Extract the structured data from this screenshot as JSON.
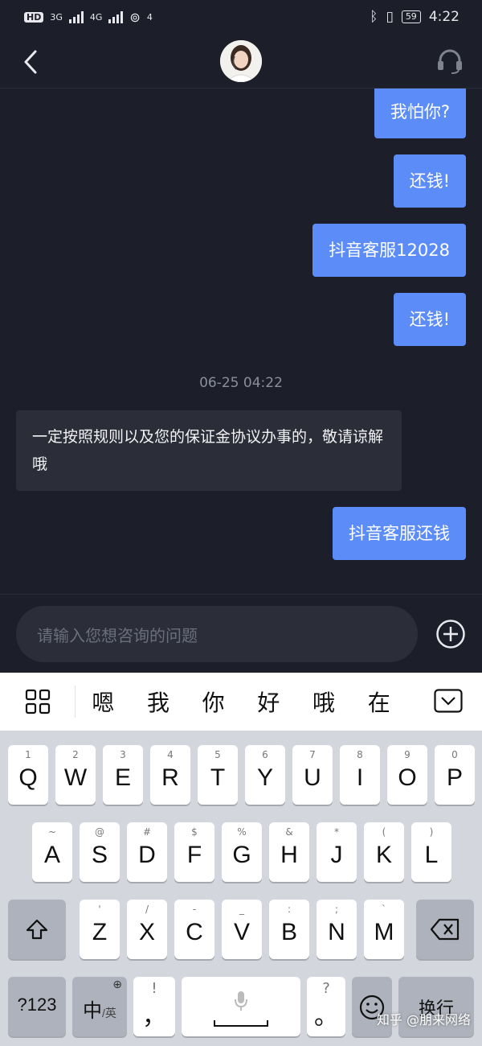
{
  "status_bar": {
    "hd_label": "HD",
    "net1": "3G",
    "net2": "4G",
    "hotspot_badge": "4",
    "battery": "59",
    "time": "4:22"
  },
  "nav": {
    "back_icon": "chevron-left-icon",
    "avatar": "customer-service-avatar",
    "headset_icon": "headset-icon"
  },
  "messages": [
    {
      "from": "me",
      "text": "我怕你?"
    },
    {
      "from": "me",
      "text": "还钱!"
    },
    {
      "from": "me",
      "text": "抖音客服12028"
    },
    {
      "from": "me",
      "text": "还钱!"
    },
    {
      "from": "timestamp",
      "text": "06-25 04:22"
    },
    {
      "from": "other",
      "text": "一定按照规则以及您的保证金协议办事的，敬请谅解哦"
    },
    {
      "from": "me",
      "text": "抖音客服还钱"
    }
  ],
  "input": {
    "placeholder": "请输入您想咨询的问题",
    "plus_icon": "plus-circle-icon"
  },
  "keyboard": {
    "candidates": [
      "嗯",
      "我",
      "你",
      "好",
      "哦",
      "在"
    ],
    "row1": [
      {
        "sub": "1",
        "main": "Q"
      },
      {
        "sub": "2",
        "main": "W"
      },
      {
        "sub": "3",
        "main": "E"
      },
      {
        "sub": "4",
        "main": "R"
      },
      {
        "sub": "5",
        "main": "T"
      },
      {
        "sub": "6",
        "main": "Y"
      },
      {
        "sub": "7",
        "main": "U"
      },
      {
        "sub": "8",
        "main": "I"
      },
      {
        "sub": "9",
        "main": "O"
      },
      {
        "sub": "0",
        "main": "P"
      }
    ],
    "row2": [
      {
        "sub": "~",
        "main": "A"
      },
      {
        "sub": "@",
        "main": "S"
      },
      {
        "sub": "#",
        "main": "D"
      },
      {
        "sub": "$",
        "main": "F"
      },
      {
        "sub": "%",
        "main": "G"
      },
      {
        "sub": "&",
        "main": "H"
      },
      {
        "sub": "*",
        "main": "J"
      },
      {
        "sub": "(",
        "main": "K"
      },
      {
        "sub": ")",
        "main": "L"
      }
    ],
    "row3": [
      {
        "sub": "'",
        "main": "Z"
      },
      {
        "sub": "/",
        "main": "X"
      },
      {
        "sub": "-",
        "main": "C"
      },
      {
        "sub": "_",
        "main": "V"
      },
      {
        "sub": ":",
        "main": "B"
      },
      {
        "sub": ";",
        "main": "N"
      },
      {
        "sub": "`",
        "main": "M"
      }
    ],
    "num_key": "?123",
    "lang_key": "中",
    "lang_sub": "/英",
    "comma_sub": "!",
    "comma_main": "，",
    "period_sub": "?",
    "period_main": "。",
    "enter_key": "换行"
  },
  "watermark": "知乎 @朋来网络"
}
